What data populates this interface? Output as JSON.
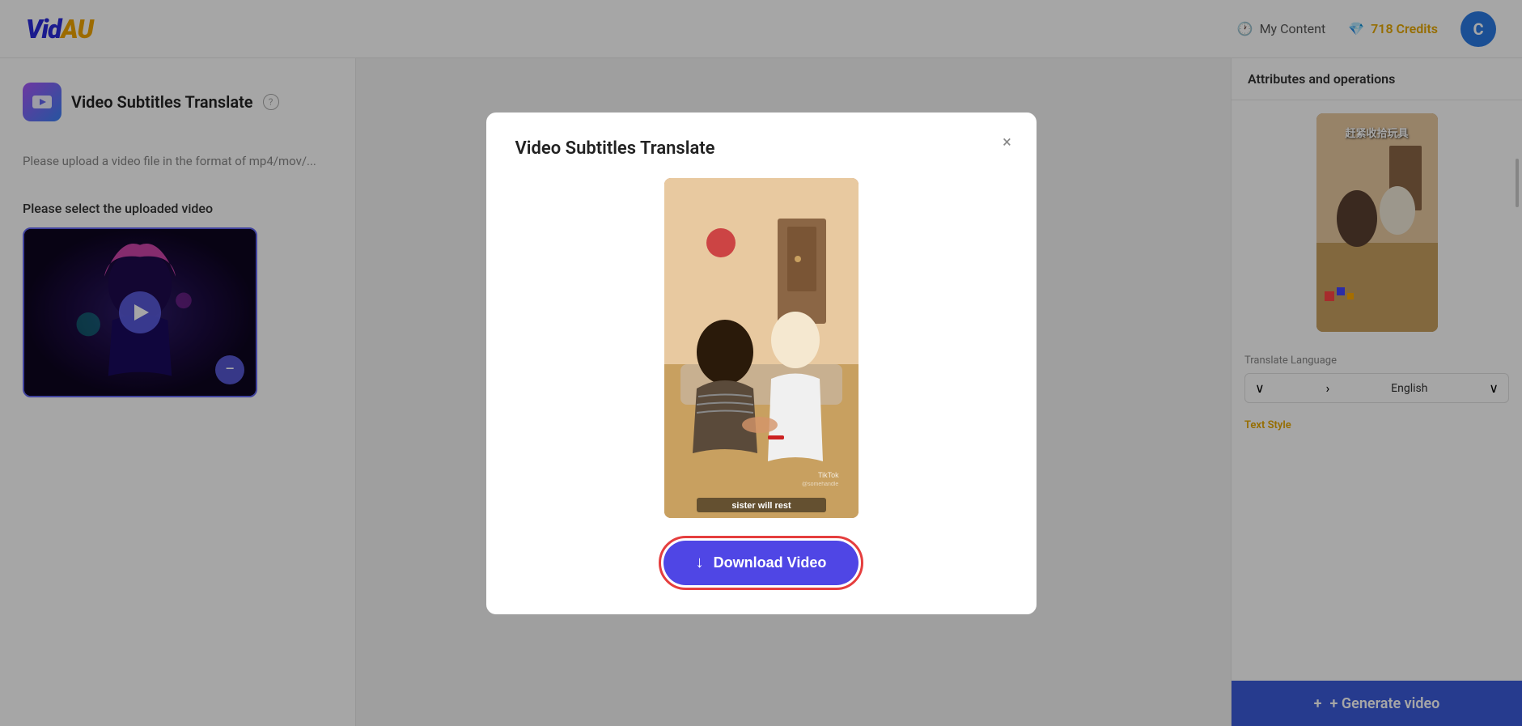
{
  "header": {
    "logo_text": "VidAU",
    "my_content_label": "My Content",
    "credits_label": "718 Credits",
    "avatar_letter": "C"
  },
  "left_panel": {
    "icon_label": "video-subtitles-icon",
    "title": "Video Subtitles Translate",
    "help_icon": "?",
    "upload_hint": "Please upload a video file in the format of mp4/mov/...",
    "select_label": "Please select the uploaded video"
  },
  "right_panel": {
    "attributes_title": "Attributes and operations",
    "translate_language_label": "Translate Language",
    "translate_language_value": "English",
    "text_style_label": "Text Style",
    "generate_label": "+ Generate video",
    "chinese_text": "赶紧收拾玩具"
  },
  "modal": {
    "title": "Video Subtitles Translate",
    "close_icon": "×",
    "subtitle_text": "sister will rest",
    "tiktok_watermark": "TikTok",
    "download_button_label": "Download Video"
  },
  "icons": {
    "clock": "🕐",
    "diamond": "💎",
    "download_arrow": "↓",
    "chevron_down": "∨",
    "chevron_right": "›",
    "plus": "+"
  }
}
